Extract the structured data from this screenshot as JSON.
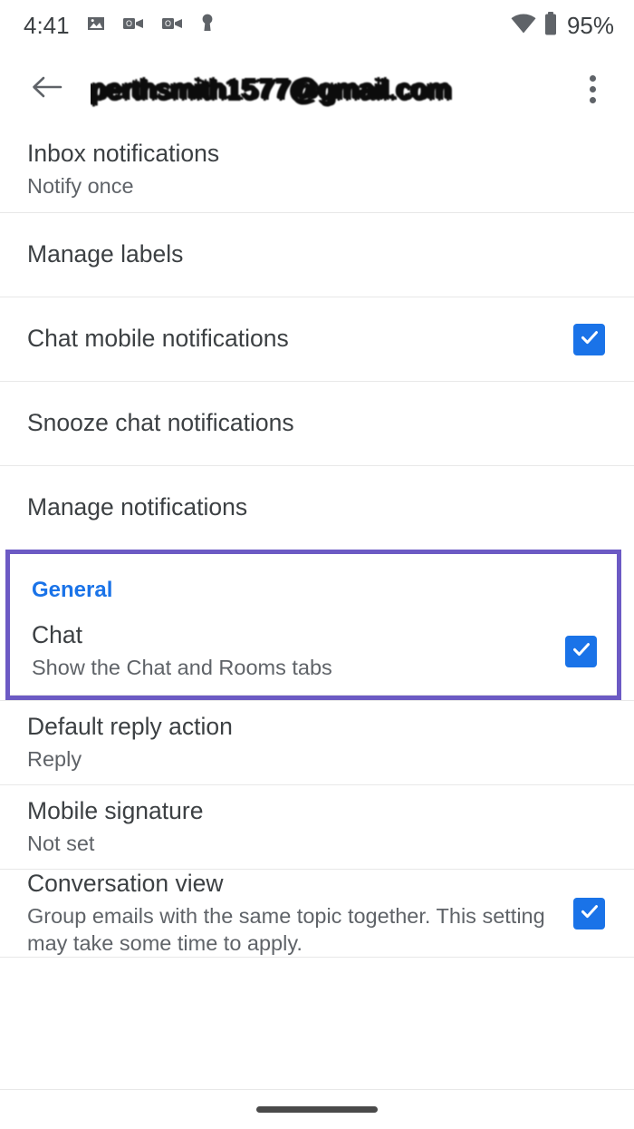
{
  "status_bar": {
    "time": "4:41",
    "battery_percent": "95%",
    "left_icons": [
      "photo-icon",
      "outlook-video-icon",
      "outlook-video-icon",
      "key-icon"
    ],
    "right_icons": [
      "wifi-icon",
      "battery-icon"
    ]
  },
  "app_bar": {
    "back_icon": "back-arrow-icon",
    "title": "perthsmith1577@gmail.com",
    "overflow_icon": "overflow-menu-icon"
  },
  "colors": {
    "accent_blue": "#1a73e8",
    "highlight_purple": "#6c5ac4",
    "text_primary": "#3c4043",
    "text_secondary": "#5f6368",
    "divider": "#e8e8e8"
  },
  "settings": {
    "rows": [
      {
        "name": "inbox-notifications",
        "title": "Inbox notifications",
        "subtitle": "Notify once",
        "checkbox": null
      },
      {
        "name": "manage-labels",
        "title": "Manage labels",
        "subtitle": null,
        "checkbox": null
      },
      {
        "name": "chat-mobile-notifications",
        "title": "Chat mobile notifications",
        "subtitle": null,
        "checkbox": "checked"
      },
      {
        "name": "snooze-chat-notifications",
        "title": "Snooze chat notifications",
        "subtitle": null,
        "checkbox": null
      },
      {
        "name": "manage-notifications",
        "title": "Manage notifications",
        "subtitle": null,
        "checkbox": null
      }
    ],
    "highlighted_group": {
      "section_label": "General",
      "highlighted": true,
      "row": {
        "name": "chat",
        "title": "Chat",
        "subtitle": "Show the Chat and Rooms tabs",
        "checkbox": "checked"
      }
    },
    "rows_after": [
      {
        "name": "default-reply-action",
        "title": "Default reply action",
        "subtitle": "Reply",
        "checkbox": null
      },
      {
        "name": "mobile-signature",
        "title": "Mobile signature",
        "subtitle": "Not set",
        "checkbox": null
      },
      {
        "name": "conversation-view",
        "title": "Conversation view",
        "subtitle": "Group emails with the same topic together. This setting may take some time to apply.",
        "checkbox": "checked"
      }
    ]
  },
  "navigation": {
    "gesture_bar": "home-gesture-bar"
  }
}
